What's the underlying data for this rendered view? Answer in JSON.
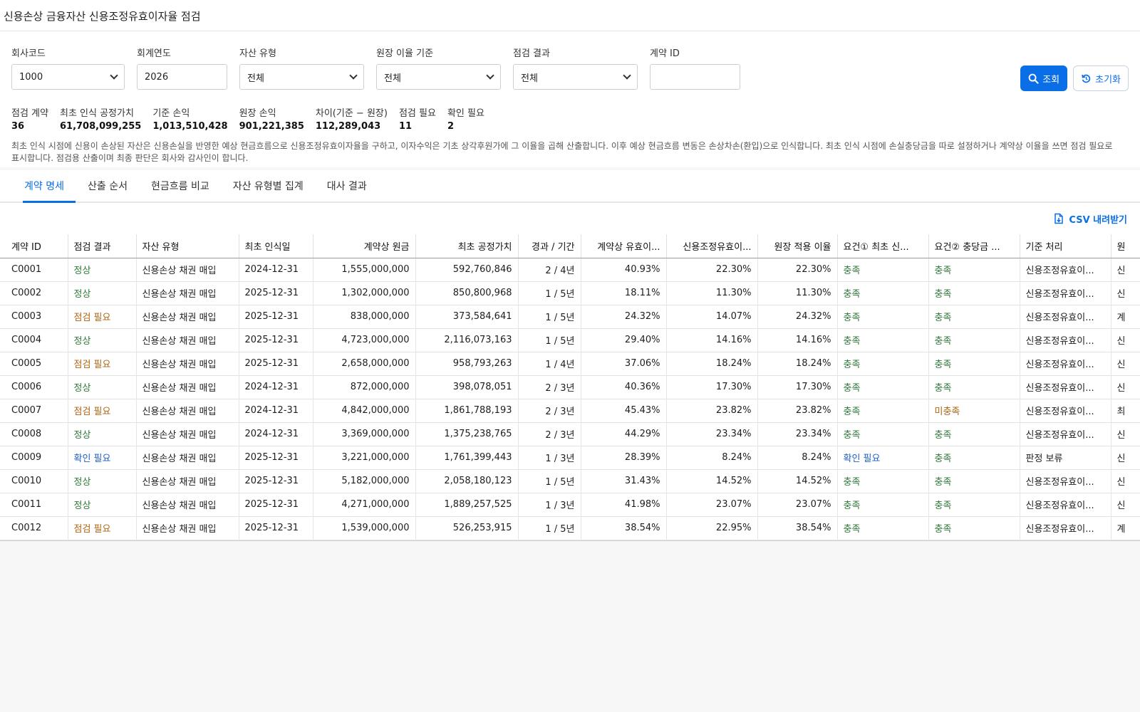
{
  "title": "신용손상 금융자산 신용조정유효이자율 점검",
  "filters": {
    "company_code": {
      "label": "회사코드",
      "value": "1000"
    },
    "fiscal_year": {
      "label": "회계연도",
      "value": "2026"
    },
    "asset_type": {
      "label": "자산 유형",
      "value": "전체"
    },
    "ledger_rate_basis": {
      "label": "원장 이율 기준",
      "value": "전체"
    },
    "check_result": {
      "label": "점검 결과",
      "value": "전체"
    },
    "contract_id": {
      "label": "계약 ID",
      "value": ""
    }
  },
  "buttons": {
    "search": "조회",
    "reset": "초기화"
  },
  "summary": [
    {
      "label": "점검 계약",
      "value": "36"
    },
    {
      "label": "최초 인식 공정가치",
      "value": "61,708,099,255"
    },
    {
      "label": "기준 손익",
      "value": "1,013,510,428"
    },
    {
      "label": "원장 손익",
      "value": "901,221,385"
    },
    {
      "label": "차이(기준 − 원장)",
      "value": "112,289,043"
    },
    {
      "label": "점검 필요",
      "value": "11"
    },
    {
      "label": "확인 필요",
      "value": "2"
    }
  ],
  "note": "최초 인식 시점에 신용이 손상된 자산은 신용손실을 반영한 예상 현금흐름으로 신용조정유효이자율을 구하고, 이자수익은 기초 상각후원가에 그 이율을 곱해 산출합니다. 이후 예상 현금흐름 변동은 손상차손(환입)으로 인식합니다. 최초 인식 시점에 손실충당금을 따로 설정하거나 계약상 이율을 쓰면 점검 필요로 표시합니다. 점검용 산출이며 최종 판단은 회사와 감사인이 합니다.",
  "tabs": [
    "계약 명세",
    "산출 순서",
    "현금흐름 비교",
    "자산 유형별 집계",
    "대사 결과"
  ],
  "active_tab": 0,
  "csv_label": "CSV 내려받기",
  "columns": [
    "계약 ID",
    "점검 결과",
    "자산 유형",
    "최초 인식일",
    "계약상 원금",
    "최초 공정가치",
    "경과 / 기간",
    "계약상 유효이...",
    "신용조정유효이...",
    "원장 적용 이율",
    "요건① 최초 신...",
    "요건② 충당금 ...",
    "기준 처리",
    "원"
  ],
  "rows": [
    [
      "C0001",
      "정상",
      "신용손상 채권 매입",
      "2024-12-31",
      "1,555,000,000",
      "592,760,846",
      "2 / 4년",
      "40.93%",
      "22.30%",
      "22.30%",
      "충족",
      "충족",
      "신용조정유효이...",
      "신"
    ],
    [
      "C0002",
      "정상",
      "신용손상 채권 매입",
      "2025-12-31",
      "1,302,000,000",
      "850,800,968",
      "1 / 5년",
      "18.11%",
      "11.30%",
      "11.30%",
      "충족",
      "충족",
      "신용조정유효이...",
      "신"
    ],
    [
      "C0003",
      "점검 필요",
      "신용손상 채권 매입",
      "2025-12-31",
      "838,000,000",
      "373,584,641",
      "1 / 5년",
      "24.32%",
      "14.07%",
      "24.32%",
      "충족",
      "충족",
      "신용조정유효이...",
      "계"
    ],
    [
      "C0004",
      "정상",
      "신용손상 채권 매입",
      "2025-12-31",
      "4,723,000,000",
      "2,116,073,163",
      "1 / 5년",
      "29.40%",
      "14.16%",
      "14.16%",
      "충족",
      "충족",
      "신용조정유효이...",
      "신"
    ],
    [
      "C0005",
      "점검 필요",
      "신용손상 채권 매입",
      "2025-12-31",
      "2,658,000,000",
      "958,793,263",
      "1 / 4년",
      "37.06%",
      "18.24%",
      "18.24%",
      "충족",
      "충족",
      "신용조정유효이...",
      "신"
    ],
    [
      "C0006",
      "정상",
      "신용손상 채권 매입",
      "2024-12-31",
      "872,000,000",
      "398,078,051",
      "2 / 3년",
      "40.36%",
      "17.30%",
      "17.30%",
      "충족",
      "충족",
      "신용조정유효이...",
      "신"
    ],
    [
      "C0007",
      "점검 필요",
      "신용손상 채권 매입",
      "2024-12-31",
      "4,842,000,000",
      "1,861,788,193",
      "2 / 3년",
      "45.43%",
      "23.82%",
      "23.82%",
      "충족",
      "미충족",
      "신용조정유효이...",
      "최"
    ],
    [
      "C0008",
      "정상",
      "신용손상 채권 매입",
      "2024-12-31",
      "3,369,000,000",
      "1,375,238,765",
      "2 / 3년",
      "44.29%",
      "23.34%",
      "23.34%",
      "충족",
      "충족",
      "신용조정유효이...",
      "신"
    ],
    [
      "C0009",
      "확인 필요",
      "신용손상 채권 매입",
      "2025-12-31",
      "3,221,000,000",
      "1,761,399,443",
      "1 / 3년",
      "28.39%",
      "8.24%",
      "8.24%",
      "확인 필요",
      "충족",
      "판정 보류",
      "신"
    ],
    [
      "C0010",
      "정상",
      "신용손상 채권 매입",
      "2025-12-31",
      "5,182,000,000",
      "2,058,180,123",
      "1 / 5년",
      "31.43%",
      "14.52%",
      "14.52%",
      "충족",
      "충족",
      "신용조정유효이...",
      "신"
    ],
    [
      "C0011",
      "정상",
      "신용손상 채권 매입",
      "2025-12-31",
      "4,271,000,000",
      "1,889,257,525",
      "1 / 3년",
      "41.98%",
      "23.07%",
      "23.07%",
      "충족",
      "충족",
      "신용조정유효이...",
      "신"
    ],
    [
      "C0012",
      "점검 필요",
      "신용손상 채권 매입",
      "2025-12-31",
      "1,539,000,000",
      "526,253,915",
      "1 / 5년",
      "38.54%",
      "22.95%",
      "38.54%",
      "충족",
      "충족",
      "신용조정유효이...",
      "계"
    ]
  ],
  "status_colors": {
    "정상": "#2f7a3b",
    "충족": "#2f7a3b",
    "점검 필요": "#b06411",
    "미충족": "#b06411",
    "확인 필요": "#1f60c4"
  }
}
